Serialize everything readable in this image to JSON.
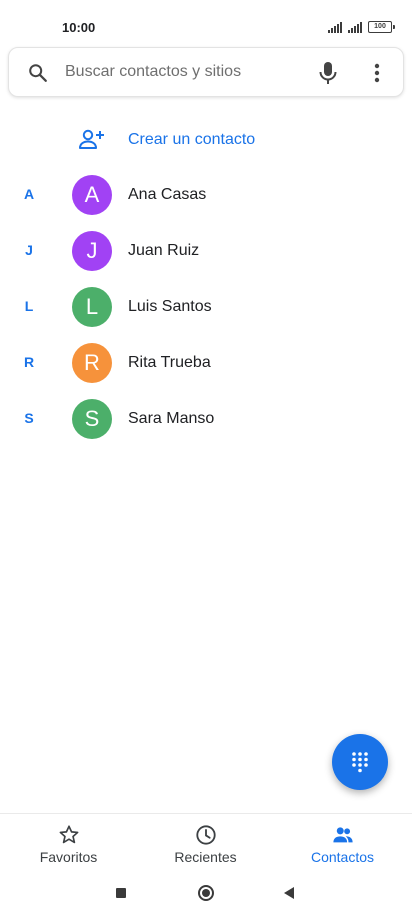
{
  "status_bar": {
    "time": "10:00",
    "battery": "100"
  },
  "search": {
    "placeholder": "Buscar contactos y sitios"
  },
  "create_contact": {
    "label": "Crear un contacto"
  },
  "contacts": [
    {
      "letter": "A",
      "initial": "A",
      "name": "Ana Casas",
      "color": "#a142f4"
    },
    {
      "letter": "J",
      "initial": "J",
      "name": "Juan Ruiz",
      "color": "#a142f4"
    },
    {
      "letter": "L",
      "initial": "L",
      "name": "Luis Santos",
      "color": "#4caf6a"
    },
    {
      "letter": "R",
      "initial": "R",
      "name": "Rita Trueba",
      "color": "#f6923b"
    },
    {
      "letter": "S",
      "initial": "S",
      "name": "Sara Manso",
      "color": "#4caf6a"
    }
  ],
  "bottom_nav": {
    "favorites": "Favoritos",
    "recents": "Recientes",
    "contacts": "Contactos"
  },
  "colors": {
    "accent": "#1a73e8",
    "fab": "#1a73e8"
  },
  "icons": [
    "search-icon",
    "mic-icon",
    "more-vert-icon",
    "person-add-icon",
    "dialpad-icon",
    "star-icon",
    "clock-icon",
    "people-icon"
  ]
}
